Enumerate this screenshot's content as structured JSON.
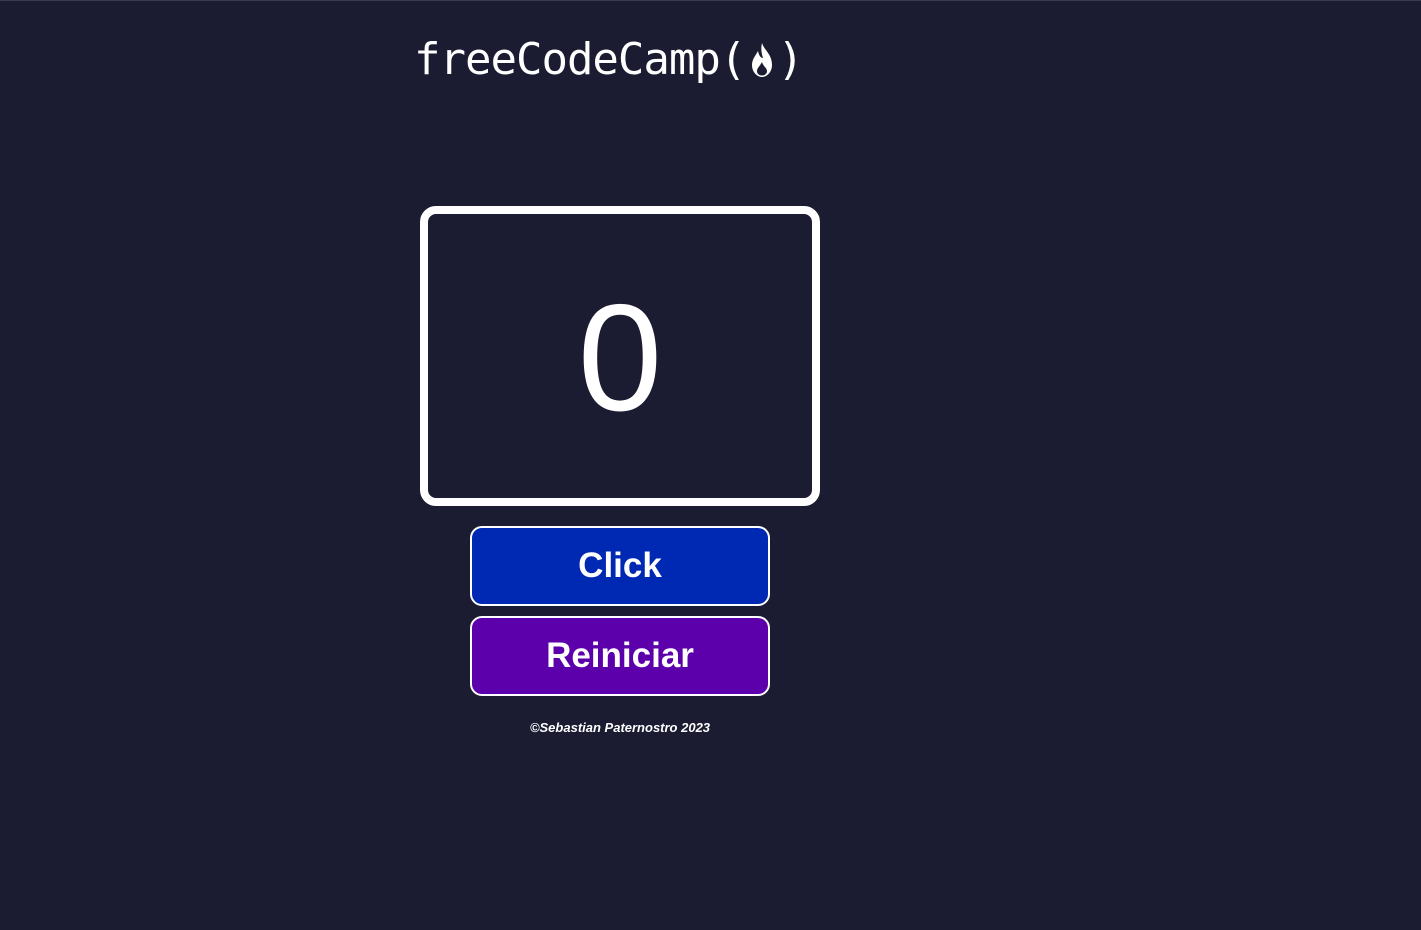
{
  "header": {
    "logo_text": "freeCodeCamp(",
    "logo_close": ")",
    "logo_icon": "flame-icon"
  },
  "counter": {
    "value": "0"
  },
  "buttons": {
    "click_label": "Click",
    "reset_label": "Reiniciar"
  },
  "footer": {
    "copyright": "©Sebastian Paternostro 2023"
  },
  "colors": {
    "background": "#1b1b32",
    "click_button": "#0029b3",
    "reset_button": "#5b00ab",
    "foreground": "#ffffff"
  }
}
